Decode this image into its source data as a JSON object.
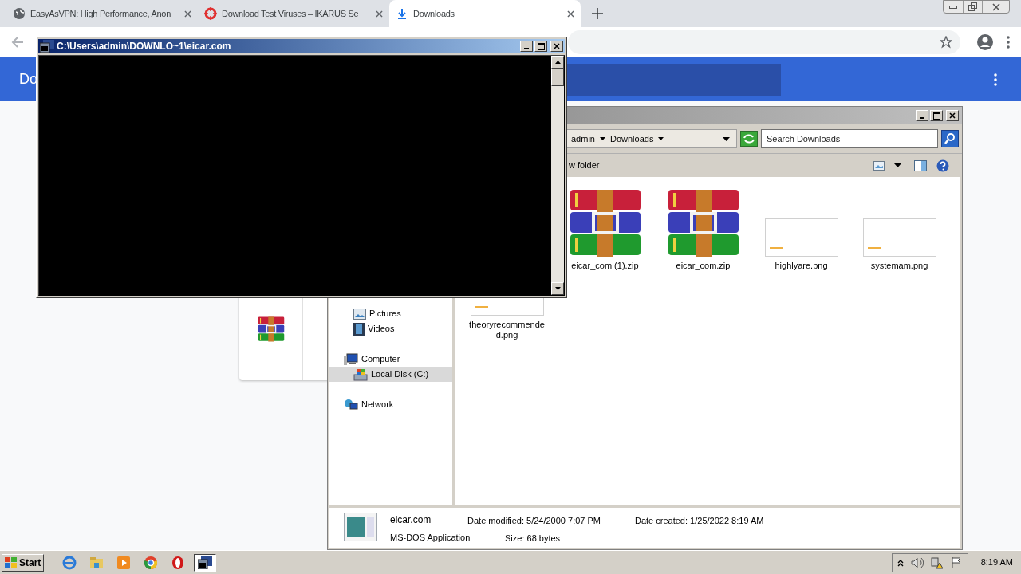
{
  "browser": {
    "tabs": [
      {
        "title": "EasyAsVPN: High Performance, Anon",
        "kind": "globe",
        "selected": false
      },
      {
        "title": "Download Test Viruses – IKARUS Se",
        "kind": "target",
        "selected": false
      },
      {
        "title": "Downloads",
        "kind": "download",
        "selected": true
      }
    ],
    "page_title": "Do"
  },
  "console_window": {
    "title": "C:\\Users\\admin\\DOWNLO~1\\eicar.com"
  },
  "explorer": {
    "breadcrumb": [
      "admin",
      "Downloads"
    ],
    "search": {
      "placeholder": "Search Downloads"
    },
    "toolbar_label": "w folder",
    "libraries": [
      {
        "label": "Pictures",
        "kind": "pictures",
        "selected": false
      },
      {
        "label": "Videos",
        "kind": "videos",
        "selected": false
      }
    ],
    "tree": [
      {
        "label": "Computer",
        "kind": "computer",
        "selected": false,
        "children": [
          {
            "label": "Local Disk (C:)",
            "kind": "disk",
            "selected": true
          }
        ]
      },
      {
        "label": "Network",
        "kind": "network",
        "selected": false
      }
    ],
    "files": [
      {
        "name": "eicar_com (1).zip",
        "kind": "archive"
      },
      {
        "name": "eicar_com.zip",
        "kind": "archive"
      },
      {
        "name": "highlyare.png",
        "kind": "image"
      },
      {
        "name": "systemam.png",
        "kind": "image"
      },
      {
        "name": "theoryrecommended.png",
        "kind": "image"
      }
    ],
    "details": {
      "name": "eicar.com",
      "type": "MS-DOS Application",
      "date_modified_label": "Date modified:",
      "date_modified": "5/24/2000 7:07 PM",
      "size_label": "Size:",
      "size": "68 bytes",
      "date_created_label": "Date created:",
      "date_created": "1/25/2022 8:19 AM"
    }
  },
  "taskbar": {
    "start": "Start",
    "apps": [
      {
        "kind": "ie",
        "active": false
      },
      {
        "kind": "folder",
        "active": false
      },
      {
        "kind": "media",
        "active": false
      },
      {
        "kind": "chrome",
        "active": false
      },
      {
        "kind": "opera",
        "active": false
      },
      {
        "kind": "console",
        "active": true
      }
    ],
    "clock": "8:19 AM"
  }
}
